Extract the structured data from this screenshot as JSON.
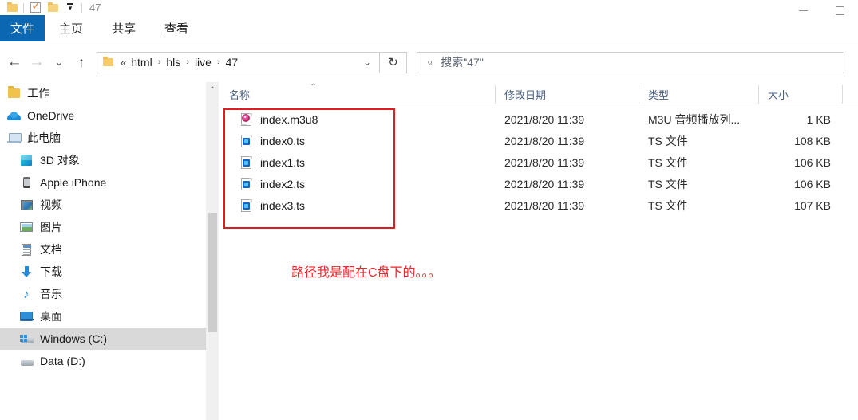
{
  "titlebar": {
    "title": "47",
    "quick_access": [
      {
        "name": "folder-icon",
        "label": ""
      },
      {
        "name": "properties-checkbox-icon",
        "label": ""
      },
      {
        "name": "new-folder-icon",
        "label": ""
      },
      {
        "name": "customize-dropdown-icon",
        "label": ""
      }
    ],
    "minimize_label": "",
    "maximize_label": ""
  },
  "ribbon": {
    "tabs": [
      {
        "label": "文件",
        "active": true
      },
      {
        "label": "主页",
        "active": false
      },
      {
        "label": "共享",
        "active": false
      },
      {
        "label": "查看",
        "active": false
      }
    ]
  },
  "nav": {
    "back_glyph": "←",
    "forward_glyph": "→",
    "history_glyph": "⌄",
    "up_glyph": "↑",
    "refresh_glyph": "↻",
    "address_caret": "⌄",
    "breadcrumb_prefix": "«",
    "breadcrumbs": [
      "html",
      "hls",
      "live",
      "47"
    ],
    "separator": "›"
  },
  "search": {
    "icon": "search-icon",
    "placeholder": "搜索\"47\""
  },
  "sidebar": {
    "scroll_up_glyph": "⌃",
    "items": [
      {
        "label": "工作",
        "icon": "folder-icon",
        "indent": 0,
        "selected": false
      },
      {
        "label": "OneDrive",
        "icon": "cloud-icon",
        "indent": 0,
        "selected": false
      },
      {
        "label": "此电脑",
        "icon": "computer-icon",
        "indent": 0,
        "selected": false
      },
      {
        "label": "3D 对象",
        "icon": "3d-objects-icon",
        "indent": 1,
        "selected": false
      },
      {
        "label": "Apple iPhone",
        "icon": "phone-icon",
        "indent": 1,
        "selected": false
      },
      {
        "label": "视频",
        "icon": "videos-icon",
        "indent": 1,
        "selected": false
      },
      {
        "label": "图片",
        "icon": "pictures-icon",
        "indent": 1,
        "selected": false
      },
      {
        "label": "文档",
        "icon": "documents-icon",
        "indent": 1,
        "selected": false
      },
      {
        "label": "下载",
        "icon": "downloads-icon",
        "indent": 1,
        "selected": false
      },
      {
        "label": "音乐",
        "icon": "music-icon",
        "indent": 1,
        "selected": false
      },
      {
        "label": "桌面",
        "icon": "desktop-icon",
        "indent": 1,
        "selected": false
      },
      {
        "label": "Windows (C:)",
        "icon": "windows-drive-icon",
        "indent": 1,
        "selected": true
      },
      {
        "label": "Data (D:)",
        "icon": "drive-icon",
        "indent": 1,
        "selected": false
      }
    ]
  },
  "filelist": {
    "columns": {
      "name": "名称",
      "date": "修改日期",
      "type": "类型",
      "size": "大小"
    },
    "sort_caret": "⌃",
    "rows": [
      {
        "name": "index.m3u8",
        "icon": "m3u8-file-icon",
        "date": "2021/8/20 11:39",
        "type": "M3U 音频播放列...",
        "size": "1 KB"
      },
      {
        "name": "index0.ts",
        "icon": "ts-file-icon",
        "date": "2021/8/20 11:39",
        "type": "TS 文件",
        "size": "108 KB"
      },
      {
        "name": "index1.ts",
        "icon": "ts-file-icon",
        "date": "2021/8/20 11:39",
        "type": "TS 文件",
        "size": "106 KB"
      },
      {
        "name": "index2.ts",
        "icon": "ts-file-icon",
        "date": "2021/8/20 11:39",
        "type": "TS 文件",
        "size": "106 KB"
      },
      {
        "name": "index3.ts",
        "icon": "ts-file-icon",
        "date": "2021/8/20 11:39",
        "type": "TS 文件",
        "size": "107 KB"
      }
    ]
  },
  "annotations": {
    "note_text": "路径我是配在C盘下的。。。",
    "highlight_color": "#e01b22",
    "note_color": "#f0252b"
  }
}
